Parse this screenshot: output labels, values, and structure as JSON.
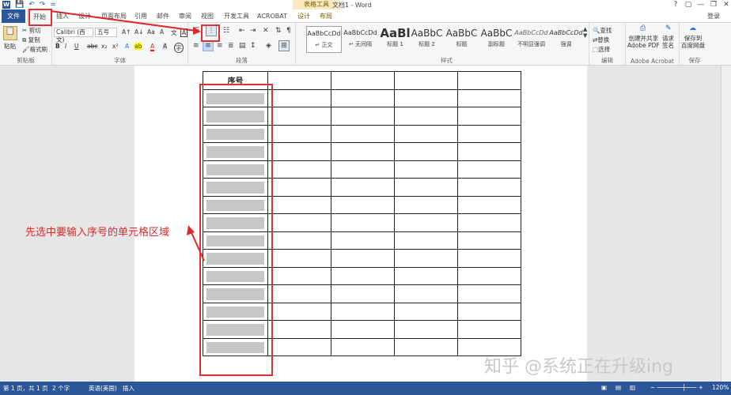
{
  "window": {
    "title": "文档1 - Word",
    "context_tab_title": "表格工具",
    "minimize": "—",
    "restore": "❐",
    "close": "✕",
    "help": "?",
    "ribbon_display": "▢"
  },
  "qat": {
    "save": "💾",
    "undo": "↶",
    "redo": "↷",
    "customize": "="
  },
  "tabs": [
    {
      "label": "文件"
    },
    {
      "label": "开始"
    },
    {
      "label": "插入"
    },
    {
      "label": "设计"
    },
    {
      "label": "页面布局"
    },
    {
      "label": "引用"
    },
    {
      "label": "邮件"
    },
    {
      "label": "审阅"
    },
    {
      "label": "视图"
    },
    {
      "label": "开发工具"
    },
    {
      "label": "ACROBAT"
    },
    {
      "label": "设计"
    },
    {
      "label": "布局"
    }
  ],
  "login": "登录",
  "clipboard": {
    "paste": "粘贴",
    "cut": "剪切",
    "copy": "复制",
    "format_painter": "格式刷",
    "label": "剪贴板"
  },
  "font": {
    "name": "Calibri (西文)",
    "size": "五号",
    "label": "字体",
    "bold": "B",
    "italic": "I",
    "underline": "U",
    "strike": "abc",
    "sub": "x₂",
    "sup": "x²",
    "grow": "A↑",
    "shrink": "A↓",
    "case": "Aa",
    "clear": "A",
    "phonetic": "文",
    "border_char": "A",
    "highlight": "ab",
    "color": "A",
    "shade": "A",
    "circle": "字"
  },
  "paragraph": {
    "label": "段落"
  },
  "styles": {
    "label": "样式",
    "items": [
      {
        "preview": "AaBbCcDd",
        "name": "↵ 正文"
      },
      {
        "preview": "AaBbCcDd",
        "name": "↵ 无间隔"
      },
      {
        "preview": "AaBl",
        "name": "标题 1"
      },
      {
        "preview": "AaBbC",
        "name": "标题 2"
      },
      {
        "preview": "AaBbC",
        "name": "标题"
      },
      {
        "preview": "AaBbC",
        "name": "副标题"
      },
      {
        "preview": "AaBbCcDd",
        "name": "不明显强调"
      },
      {
        "preview": "AaBbCcDd",
        "name": "强调"
      }
    ]
  },
  "editing": {
    "find": "查找",
    "replace": "替换",
    "select": "选择",
    "label": "编辑"
  },
  "acrobat": {
    "create_share": "创建并共享\nAdobe PDF",
    "request_sign": "请求\n签名",
    "label": "Adobe Acrobat"
  },
  "save_group": {
    "save_baidu": "保存到\n百度网盘",
    "label": "保存"
  },
  "document": {
    "header_cell": "序号",
    "rows": 16,
    "cols": 5
  },
  "annotation": "先选中要输入序号的单元格区域",
  "watermark": "知乎 @系统正在升级ing",
  "status": {
    "page": "第 1 页，共 1 页",
    "words": "2 个字",
    "lang": "英语(美国)",
    "mode": "插入",
    "zoom": "120%"
  },
  "colors": {
    "word_blue": "#2b579a",
    "annotation_red": "#e02828",
    "cell_shade": "#c6c6c6"
  }
}
